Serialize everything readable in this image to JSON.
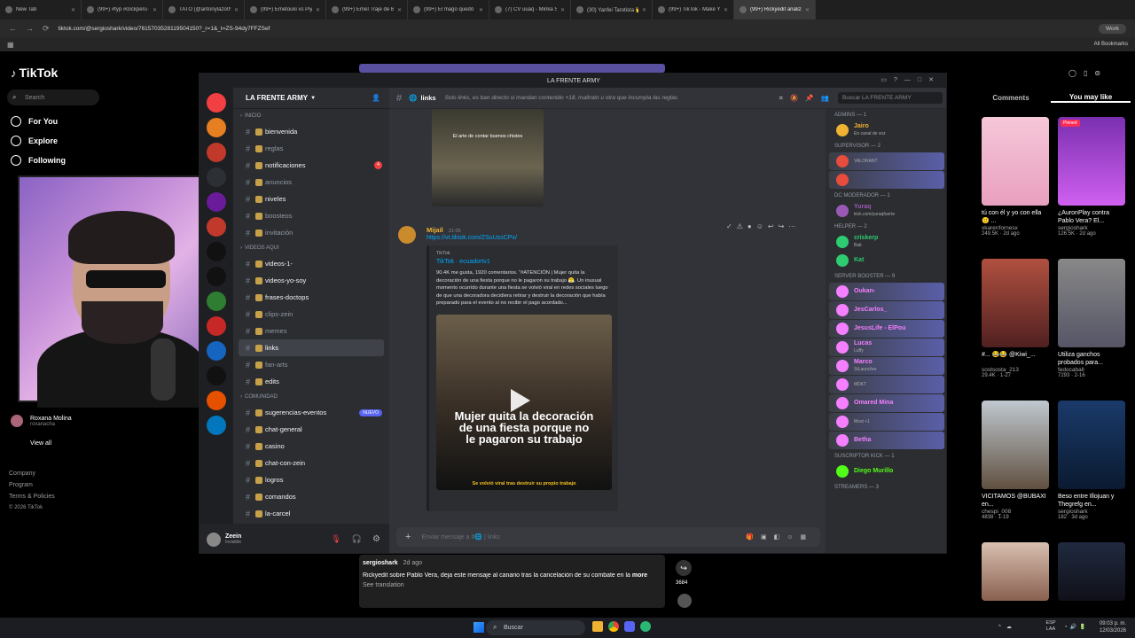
{
  "browser": {
    "tabs": [
      {
        "title": "New Tab"
      },
      {
        "title": "(99+) #fyp #clickperu #carlitos"
      },
      {
        "title": "TATO (@antonylazo09) | TikTok"
      },
      {
        "title": "(99+) Emetouki vs Piyadoli La"
      },
      {
        "title": "(99+) Ernel Traje de Baño Lo"
      },
      {
        "title": "(99+) El mago quedó encanta"
      },
      {
        "title": "(7) CV uuaq - Minka Sound G"
      },
      {
        "title": "(30) Yanfei Tarotista 👑 on X"
      },
      {
        "title": "(99+) TikTok - Make Your Day"
      },
      {
        "title": "(99+) Rickyedit analiza la cano"
      }
    ],
    "url": "tiktok.com/@sergioshark/video/7615703528119504150?_r=1&_t=ZS-94dy7FFZSef",
    "profile": "Work",
    "bookmarks": "All Bookmarks"
  },
  "tiktok_left": {
    "logo": "TikTok",
    "search_placeholder": "Search",
    "nav": [
      {
        "label": "For You"
      },
      {
        "label": "Explore"
      },
      {
        "label": "Following"
      }
    ],
    "following_user": {
      "name": "Roxana Molina",
      "handle": "roxanacha"
    },
    "view_all": "View all",
    "footer": [
      "Company",
      "Program",
      "Terms & Policies",
      "© 2026 TikTok"
    ]
  },
  "discord": {
    "window_title": "LA FRENTE ARMY",
    "server_name": "LA FRENTE ARMY",
    "channel_header": {
      "name": "links",
      "topic": "Solo links, es ban directo si mandan contenido +18, maltrato u otra que incumpla las reglas"
    },
    "member_search_placeholder": "Buscar LA FRENTE ARMY",
    "categories": [
      {
        "name": "INICIO",
        "channels": [
          {
            "label": "bienvenida",
            "bright": true
          },
          {
            "label": "reglas",
            "bright": false
          },
          {
            "label": "notificaciones",
            "bright": true,
            "badge": "4"
          },
          {
            "label": "anuncios",
            "bright": false
          },
          {
            "label": "niveles",
            "bright": true
          },
          {
            "label": "boosteos",
            "bright": false
          },
          {
            "label": "invitación",
            "bright": false
          }
        ]
      },
      {
        "name": "VIDEOS AQUI",
        "channels": [
          {
            "label": "videos-1-",
            "bright": true
          },
          {
            "label": "videos-yo-soy",
            "bright": true
          },
          {
            "label": "frases-doctops",
            "bright": true
          },
          {
            "label": "clips-zein",
            "bright": false
          },
          {
            "label": "memes",
            "bright": false
          },
          {
            "label": "links",
            "bright": true,
            "selected": true
          },
          {
            "label": "fan-arts",
            "bright": false
          },
          {
            "label": "edits",
            "bright": true
          }
        ]
      },
      {
        "name": "COMUNIDAD",
        "channels": [
          {
            "label": "sugerencias-eventos",
            "bright": true,
            "new": "NUEVO"
          },
          {
            "label": "chat-general",
            "bright": true
          },
          {
            "label": "casino",
            "bright": true
          },
          {
            "label": "chat-con-zein",
            "bright": true
          },
          {
            "label": "logros",
            "bright": true
          },
          {
            "label": "comandos",
            "bright": true
          },
          {
            "label": "la-carcel",
            "bright": true
          }
        ]
      }
    ],
    "user": {
      "name": "Zeein",
      "status": "Invisible"
    },
    "message": {
      "author": "Mijail",
      "time": "21:05",
      "link": "https://vt.tiktok.com/ZSuUssCPx/",
      "embed_provider": "TikTok",
      "embed_title": "TikTok · ecuadortv1",
      "embed_desc": "90.4K me gusta, 1920 comentarios. \"#ATENCIÓN | Mujer quita la decoración de una fiesta porque no le pagaron su trabajo 😤. Un inusual momento ocurrido durante una fiesta se volvió viral en redes sociales luego de que una decoradora decidiera retirar y destruir la decoración que había preparado para el evento al no recibir el pago acordado...",
      "video_caption": "Mujer quita la decoración de una fiesta porque no le pagaron su trabajo",
      "video_subcaption": "Se volvió viral tras destruir su propio trabajo",
      "prev_image_caption": "El arte de contar buenos chistes"
    },
    "input_placeholder": "Enviar mensaje a #🌐 | links",
    "member_groups": [
      {
        "title": "Admins — 1",
        "members": [
          {
            "name": "Jairo",
            "sub": "En canal de voz",
            "color": "#f0b232"
          }
        ]
      },
      {
        "title": "SUPERVISOR — 2",
        "members": [
          {
            "name": "",
            "sub": "VALORANT",
            "color": "#e74c3c"
          },
          {
            "name": "",
            "sub": "",
            "color": "#e74c3c"
          }
        ]
      },
      {
        "title": "DC Moderador — 1",
        "members": [
          {
            "name": "Yuraq",
            "sub": "kick.com/yuraqfuerte",
            "color": "#9b59b6"
          }
        ]
      },
      {
        "title": "Helper — 2",
        "members": [
          {
            "name": "criskerp",
            "sub": "Bait",
            "color": "#2ecc71"
          },
          {
            "name": "Kat",
            "sub": "",
            "color": "#2ecc71"
          }
        ]
      },
      {
        "title": "Server booster — 9",
        "members": [
          {
            "name": "Oukan-",
            "sub": "",
            "color": "#f47fff"
          },
          {
            "name": "JesCarlos_",
            "sub": "",
            "color": "#f47fff"
          },
          {
            "name": "JesusLife - ElPou",
            "sub": "",
            "color": "#f47fff"
          },
          {
            "name": "Lucas",
            "sub": "Luffy",
            "color": "#f47fff"
          },
          {
            "name": "Marco",
            "sub": "StLauncher",
            "color": "#f47fff"
          },
          {
            "name": "",
            "sub": "MDKT",
            "color": "#f47fff"
          },
          {
            "name": "Omared Mina",
            "sub": "",
            "color": "#f47fff"
          },
          {
            "name": "",
            "sub": "Most +1",
            "color": "#f47fff"
          },
          {
            "name": "Betha",
            "sub": "",
            "color": "#f47fff"
          }
        ]
      },
      {
        "title": "Suscriptor KICK — 1",
        "members": [
          {
            "name": "Diego Murillo",
            "sub": "",
            "color": "#53fc18"
          }
        ]
      },
      {
        "title": "Streamers — 3",
        "members": []
      }
    ]
  },
  "tiktok_right": {
    "tabs": [
      "Comments",
      "You may like"
    ],
    "cards": [
      {
        "caption": "tú con él y yo con ella 🙂 ...",
        "author": "xkarenfornesx",
        "stats": "249.5K · 2d ago"
      },
      {
        "caption": "¿AuronPlay contra Pablo Vera? El...",
        "author": "sergioshark",
        "stats": "126.5K · 2d ago",
        "pinned": "Pinned"
      },
      {
        "caption": "#... 😂😂 @Kiwi_...",
        "author": "sostsosta_213",
        "stats": "29.4K · 1-27"
      },
      {
        "caption": "Utiliza ganchos probados para...",
        "author": "fedocaball",
        "stats": "7293 · 2-16"
      },
      {
        "caption": "VICITAMOS @BUBAXI en...",
        "author": "chespi_008",
        "stats": "4838 · 1-19"
      },
      {
        "caption": "Beso entre Illojuan y Thegrefg en...",
        "author": "sergioshark",
        "stats": "182 · 3d ago"
      }
    ]
  },
  "player": {
    "author": "sergioshark",
    "time": "2d ago",
    "text": "Rickyedit sobre Pablo Vera, deja este mensaje al canario tras la cancelación de su combate en la",
    "more": "more",
    "translate": "See translation",
    "shares": "3684"
  },
  "taskbar": {
    "search": "Buscar",
    "lang": "ESP LAA",
    "time": "09:03 p. m.",
    "date": "12/03/2026"
  }
}
